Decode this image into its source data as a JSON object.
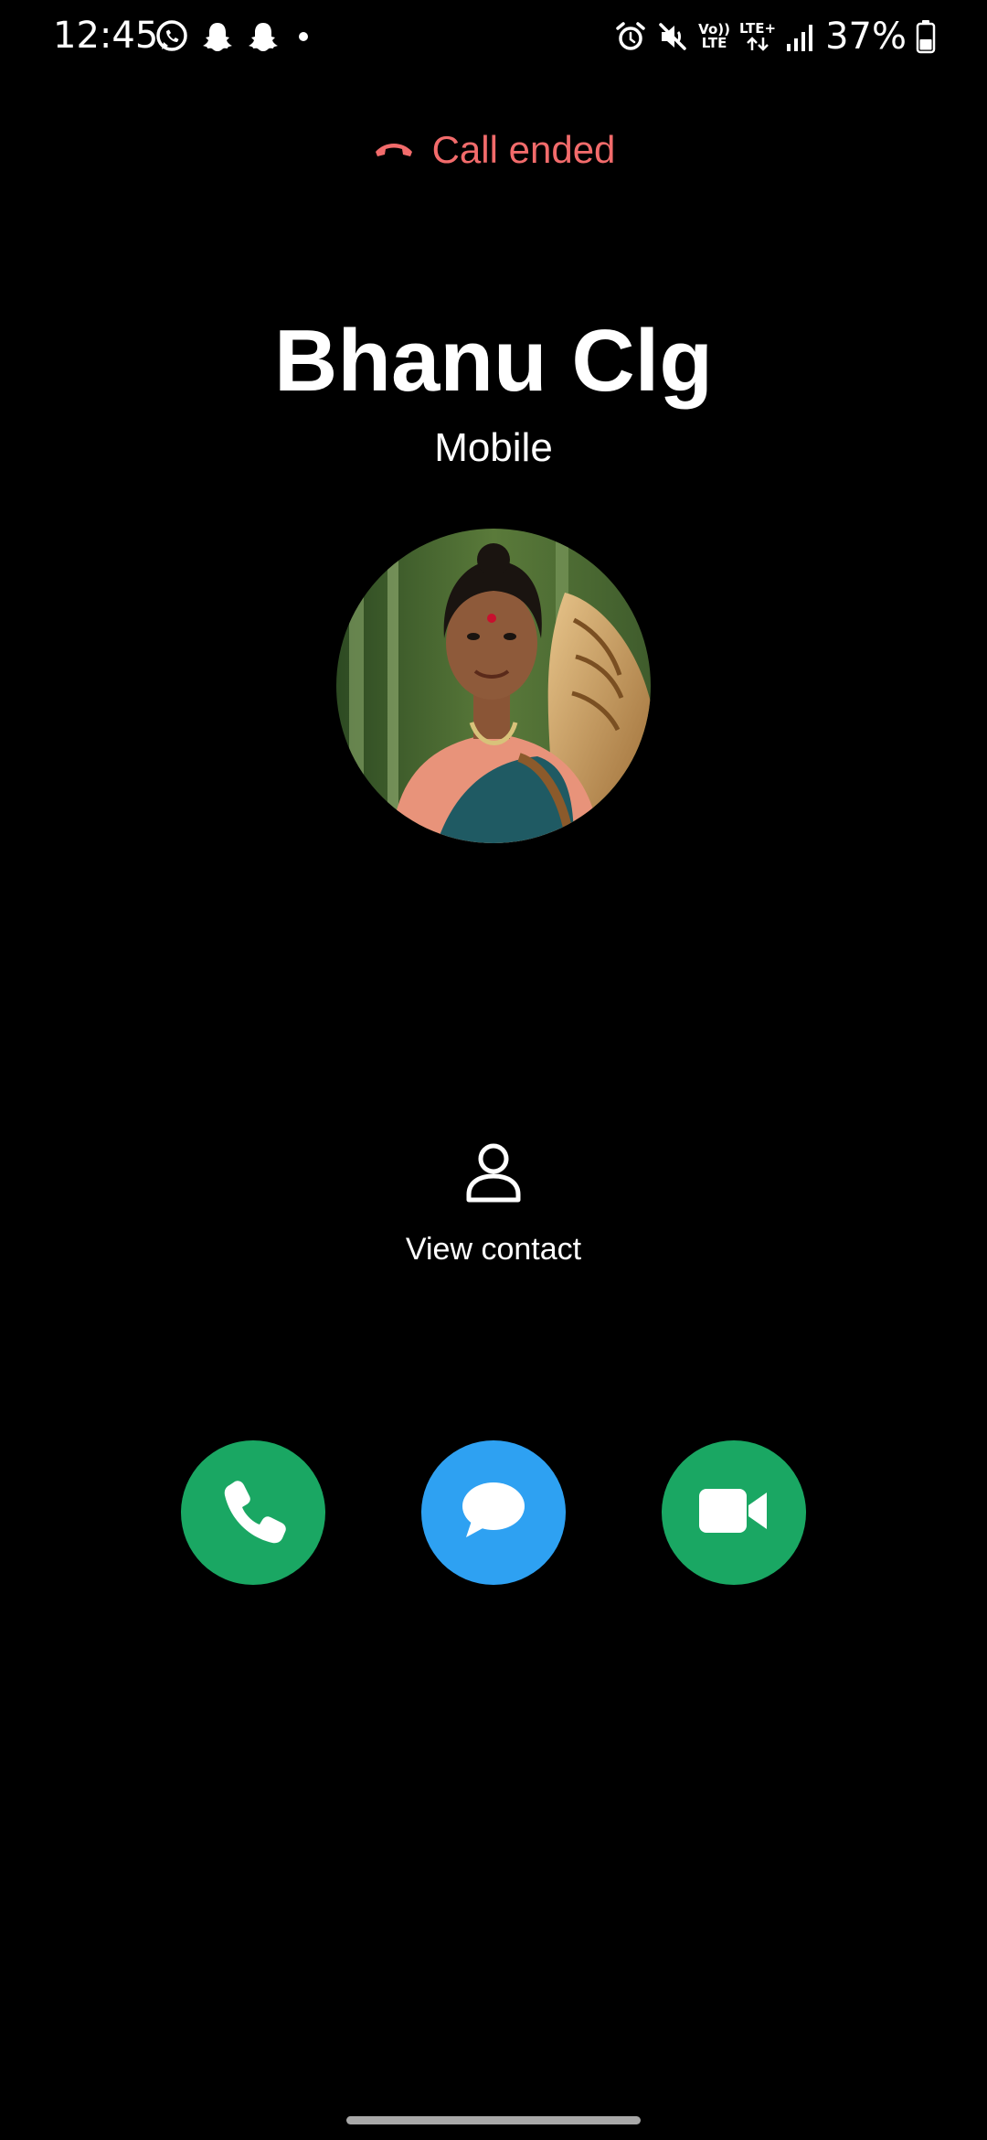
{
  "status_bar": {
    "time": "12:45",
    "left_icons": [
      "whatsapp-icon",
      "snapchat-icon",
      "snapchat-icon",
      "dot-icon"
    ],
    "right_icons": [
      "alarm-icon",
      "mute-icon",
      "volte-icon",
      "lte-plus-icon",
      "signal-icon",
      "battery-icon"
    ],
    "network_volte_top": "Vo))",
    "network_volte_bottom": "LTE",
    "network_lte": "LTE+",
    "battery_percent": "37%"
  },
  "call": {
    "status": "Call ended",
    "status_icon": "call-end-icon",
    "status_color": "#f26b6b"
  },
  "contact": {
    "name": "Bhanu Clg",
    "label": "Mobile",
    "photo_icon": "contact-photo"
  },
  "view_contact": {
    "label": "View contact",
    "icon": "person-icon"
  },
  "actions": [
    {
      "name": "call",
      "icon": "phone-icon",
      "color": "#1aa763"
    },
    {
      "name": "message",
      "icon": "message-icon",
      "color": "#2ea1f2"
    },
    {
      "name": "video-call",
      "icon": "video-icon",
      "color": "#1aa763"
    }
  ]
}
